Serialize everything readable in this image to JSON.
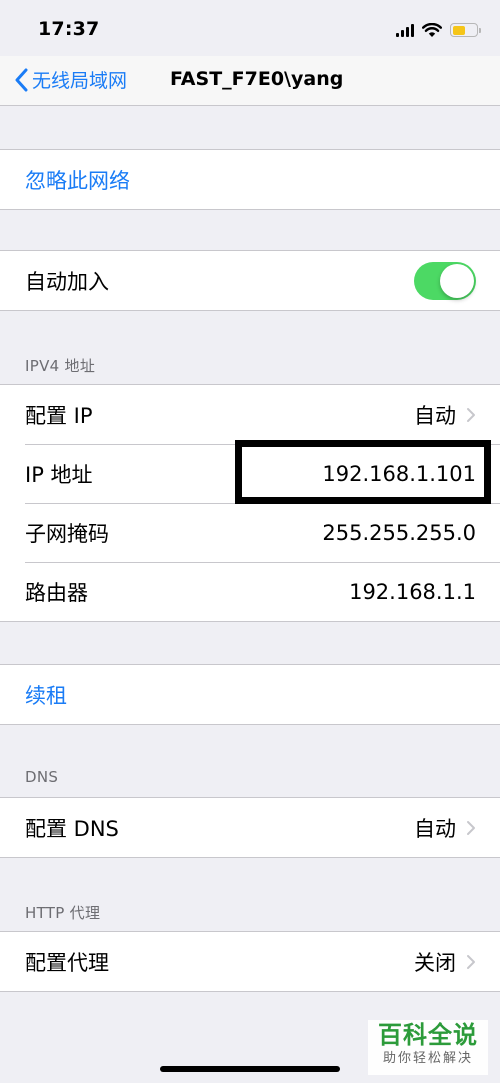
{
  "status_bar": {
    "time": "17:37"
  },
  "nav": {
    "back_label": "无线局域网",
    "title": "FAST_F7E0\\yang"
  },
  "forget_network": {
    "label": "忽略此网络"
  },
  "auto_join": {
    "label": "自动加入",
    "enabled": true
  },
  "ipv4": {
    "header": "IPV4 地址",
    "rows": [
      {
        "label": "配置 IP",
        "value": "自动"
      },
      {
        "label": "IP 地址",
        "value": "192.168.1.101"
      },
      {
        "label": "子网掩码",
        "value": "255.255.255.0"
      },
      {
        "label": "路由器",
        "value": "192.168.1.1"
      }
    ]
  },
  "renew_lease": {
    "label": "续租"
  },
  "dns": {
    "header": "DNS",
    "configure_label": "配置 DNS",
    "configure_value": "自动"
  },
  "http_proxy": {
    "header": "HTTP 代理",
    "configure_label": "配置代理",
    "configure_value": "关闭"
  },
  "watermark": {
    "main": "百科全说",
    "sub": "助你轻松解决"
  },
  "colors": {
    "accent": "#1a7cf6",
    "toggle_on": "#4cd964",
    "background": "#efeff4",
    "battery": "#f5c518"
  }
}
